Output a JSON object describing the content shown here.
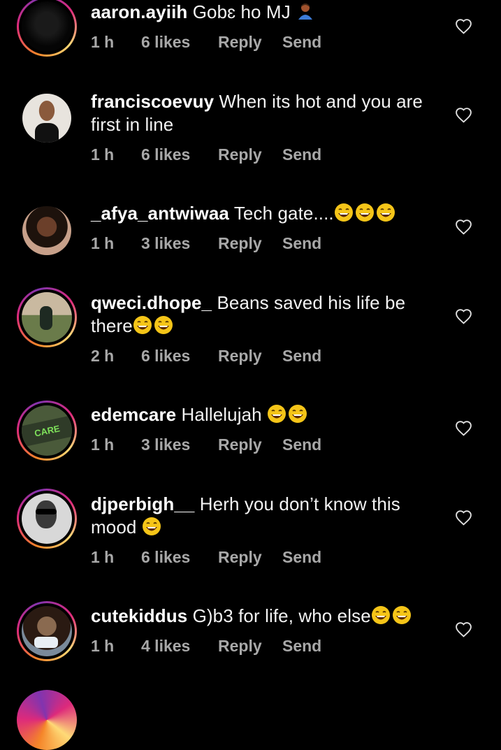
{
  "comments": [
    {
      "username": "aaron.ayiih",
      "text": "Gobɛ ho MJ",
      "emojis": [
        "person-bowing-emoji"
      ],
      "time": "1 h",
      "likes": "6 likes",
      "reply": "Reply",
      "send": "Send"
    },
    {
      "username": "franciscoevuy",
      "text": "When its hot and you are first in line",
      "emojis": [],
      "time": "1 h",
      "likes": "6 likes",
      "reply": "Reply",
      "send": "Send"
    },
    {
      "username": "_afya_antwiwaa",
      "text": "Tech gate....",
      "emojis": [
        "laughing-emoji",
        "laughing-emoji",
        "laughing-emoji"
      ],
      "time": "1 h",
      "likes": "3 likes",
      "reply": "Reply",
      "send": "Send"
    },
    {
      "username": "qweci.dhope_",
      "text": "Beans saved his life be there",
      "emojis": [
        "laughing-emoji",
        "laughing-emoji"
      ],
      "time": "2 h",
      "likes": "6 likes",
      "reply": "Reply",
      "send": "Send"
    },
    {
      "username": "edemcare",
      "text": "Hallelujah ",
      "emojis": [
        "laughing-emoji",
        "laughing-emoji"
      ],
      "time": "1 h",
      "likes": "3 likes",
      "reply": "Reply",
      "send": "Send",
      "avatar_text": "CARE"
    },
    {
      "username": "djperbigh__",
      "text": "Herh you don’t know this mood ",
      "emojis": [
        "laughing-emoji"
      ],
      "time": "1 h",
      "likes": "6 likes",
      "reply": "Reply",
      "send": "Send"
    },
    {
      "username": "cutekiddus",
      "text": "G)b3 for life, who else",
      "emojis": [
        "laughing-emoji",
        "laughing-emoji"
      ],
      "time": "1 h",
      "likes": "4 likes",
      "reply": "Reply",
      "send": "Send"
    }
  ],
  "colors": {
    "background": "#000000",
    "text": "#f2f2f2",
    "meta": "#a8a8a8"
  }
}
